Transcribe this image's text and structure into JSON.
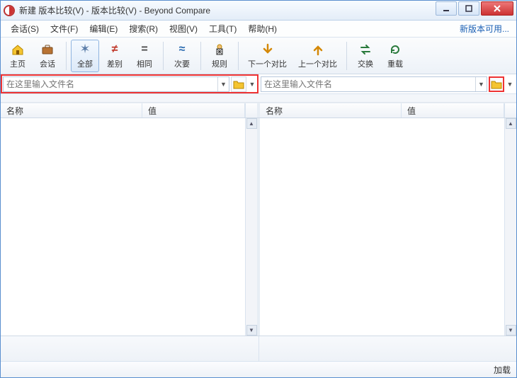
{
  "titlebar": {
    "title": "新建 版本比较(V) - 版本比较(V) - Beyond Compare"
  },
  "menus": {
    "session": "会话(S)",
    "file": "文件(F)",
    "edit": "编辑(E)",
    "search": "搜索(R)",
    "view": "视图(V)",
    "tools": "工具(T)",
    "help": "帮助(H)",
    "update_link": "新版本可用..."
  },
  "toolbar": {
    "home": "主页",
    "session": "会话",
    "all": "全部",
    "diff": "差别",
    "same": "相同",
    "minor": "次要",
    "rules": "规则",
    "next_diff": "下一个对比",
    "prev_diff": "上一个对比",
    "swap": "交换",
    "reload": "重载"
  },
  "paths": {
    "left_placeholder": "在这里输入文件名",
    "right_placeholder": "在这里输入文件名"
  },
  "columns": {
    "name": "名称",
    "value": "值"
  },
  "status": {
    "text": "加载"
  }
}
